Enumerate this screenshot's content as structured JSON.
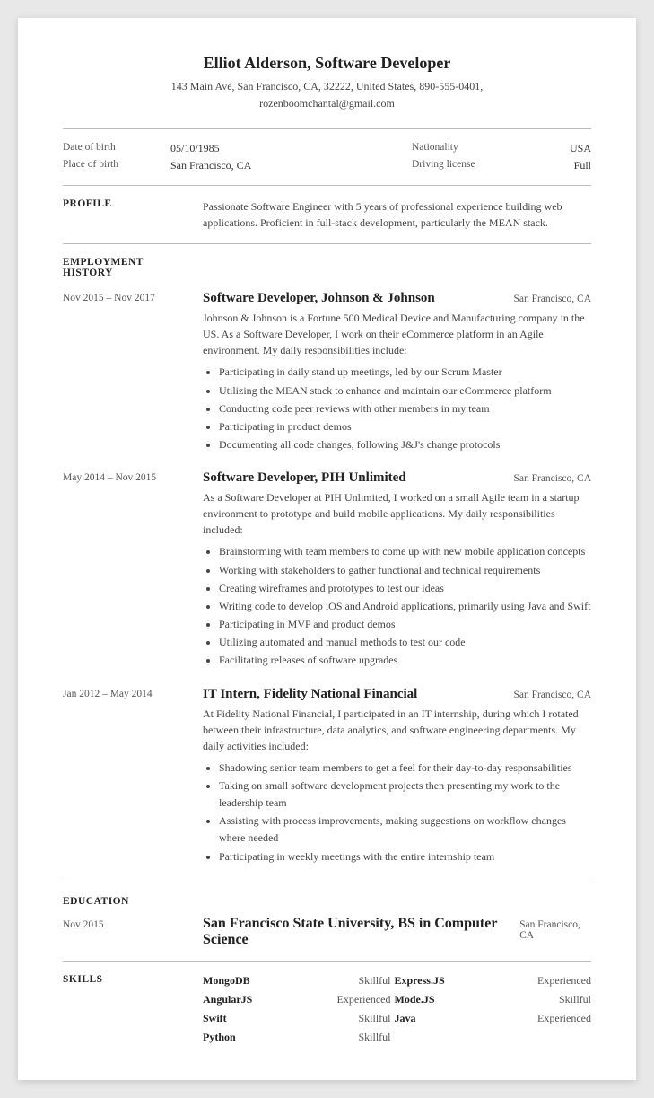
{
  "header": {
    "name": "Elliot Alderson, Software Developer",
    "address": "143 Main Ave, San Francisco, CA, 32222, United States, 890-555-0401,",
    "email": "rozenboomchantal@gmail.com"
  },
  "info": {
    "dob_label": "Date of birth",
    "dob_value": "05/10/1985",
    "nationality_label": "Nationality",
    "nationality_value": "USA",
    "pob_label": "Place of birth",
    "pob_value": "San Francisco, CA",
    "license_label": "Driving license",
    "license_value": "Full"
  },
  "profile": {
    "section_title": "PROFILE",
    "content": "Passionate Software Engineer with 5 years of professional experience building web applications. Proficient in full-stack development, particularly the MEAN stack."
  },
  "employment": {
    "section_title": "EMPLOYMENT HISTORY",
    "jobs": [
      {
        "dates": "Nov 2015 – Nov 2017",
        "title": "Software Developer, Johnson & Johnson",
        "location": "San Francisco, CA",
        "description": "Johnson & Johnson is a Fortune 500 Medical Device and Manufacturing company in the US. As a Software Developer, I work on their eCommerce platform in an Agile environment. My daily responsibilities include:",
        "bullets": [
          "Participating in daily stand up meetings, led by our Scrum Master",
          "Utilizing the MEAN stack to enhance and maintain our eCommerce platform",
          "Conducting code peer reviews with other members in my team",
          "Participating in product demos",
          "Documenting all code changes, following J&J's change protocols"
        ]
      },
      {
        "dates": "May 2014 – Nov 2015",
        "title": "Software Developer, PIH Unlimited",
        "location": "San Francisco, CA",
        "description": "As a Software Developer at PIH Unlimited, I worked on a small Agile team in a startup environment to prototype and build mobile applications. My daily responsibilities included:",
        "bullets": [
          "Brainstorming with team members to come up with new mobile application concepts",
          "Working with stakeholders to gather functional and technical requirements",
          "Creating wireframes and prototypes to test our ideas",
          "Writing code to develop iOS and Android applications, primarily using Java and Swift",
          "Participating in MVP and product demos",
          "Utilizing automated and manual methods to test our code",
          "Facilitating releases of software upgrades"
        ]
      },
      {
        "dates": "Jan 2012 – May 2014",
        "title": "IT Intern, Fidelity National Financial",
        "location": "San Francisco, CA",
        "description": "At Fidelity National Financial, I participated in an IT internship, during which I rotated between their infrastructure, data analytics, and software engineering departments. My daily activities included:",
        "bullets": [
          "Shadowing senior team members to get a feel for their day-to-day responsabilities",
          "Taking on small software development projects then presenting my work to the leadership team",
          "Assisting with process improvements, making suggestions on workflow changes where needed",
          "Participating in weekly meetings with the entire internship team"
        ]
      }
    ]
  },
  "education": {
    "section_title": "EDUCATION",
    "entries": [
      {
        "dates": "Nov 2015",
        "title": "San Francisco State University, BS in Computer Science",
        "location": "San Francisco, CA"
      }
    ]
  },
  "skills": {
    "section_title": "SKILLS",
    "items": [
      {
        "name": "MongoDB",
        "level": "Skillful",
        "name2": "Express.JS",
        "level2": "Experienced"
      },
      {
        "name": "AngularJS",
        "level": "Experienced",
        "name2": "Mode.JS",
        "level2": "Skillful"
      },
      {
        "name": "Swift",
        "level": "Skillful",
        "name2": "Java",
        "level2": "Experienced"
      },
      {
        "name": "Python",
        "level": "Skillful",
        "name2": "",
        "level2": ""
      }
    ]
  }
}
